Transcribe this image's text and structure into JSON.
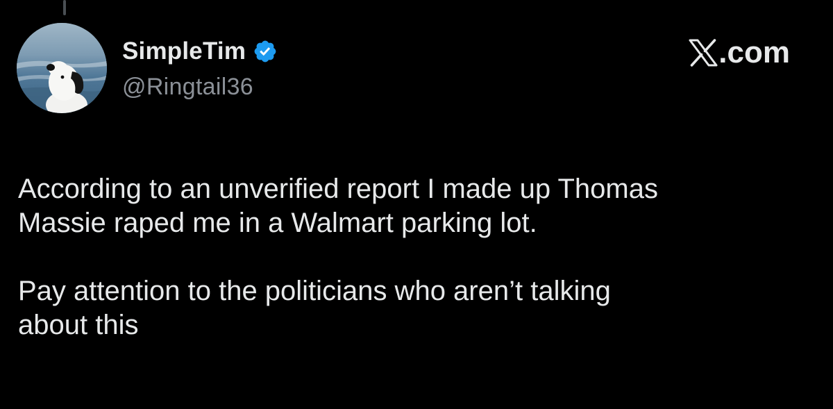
{
  "post": {
    "author": {
      "display_name": "SimpleTim",
      "handle": "@Ringtail36",
      "verified": true,
      "badge_color": "#1d9bf0",
      "avatar_icon": "snoopy-beach-avatar"
    },
    "brand": {
      "label": ".com",
      "icon": "x-logo-icon"
    },
    "text": {
      "paragraph_1": "According to an unverified report I made up Thomas\nMassie raped me in a Walmart parking lot.",
      "paragraph_2": "Pay attention to the politicians who aren’t talking\nabout this"
    }
  },
  "colors": {
    "background": "#000000",
    "primary_text": "#e7e9ea",
    "secondary_text": "#8b9097"
  }
}
